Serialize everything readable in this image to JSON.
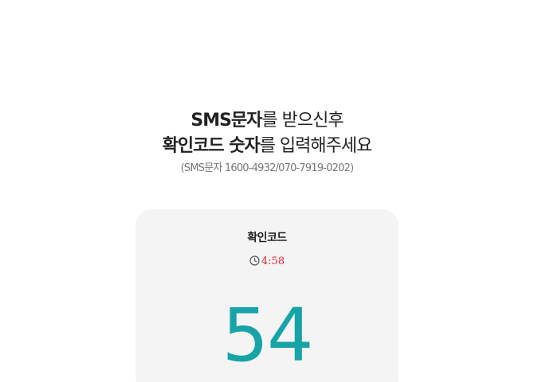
{
  "heading": {
    "line1_bold": "SMS문자",
    "line1_rest": "를 받으신후",
    "line2_bold": "확인코드 숫자",
    "line2_rest": "를 입력해주세요",
    "sub": "(SMS문자 1600-4932/070-7919-0202)"
  },
  "card": {
    "title": "확인코드",
    "timer_icon": "clock-icon",
    "timer": "4:58",
    "code": "54"
  },
  "colors": {
    "timer": "#e0283a",
    "code": "#17a3a8",
    "card_bg": "#f4f4f4"
  }
}
